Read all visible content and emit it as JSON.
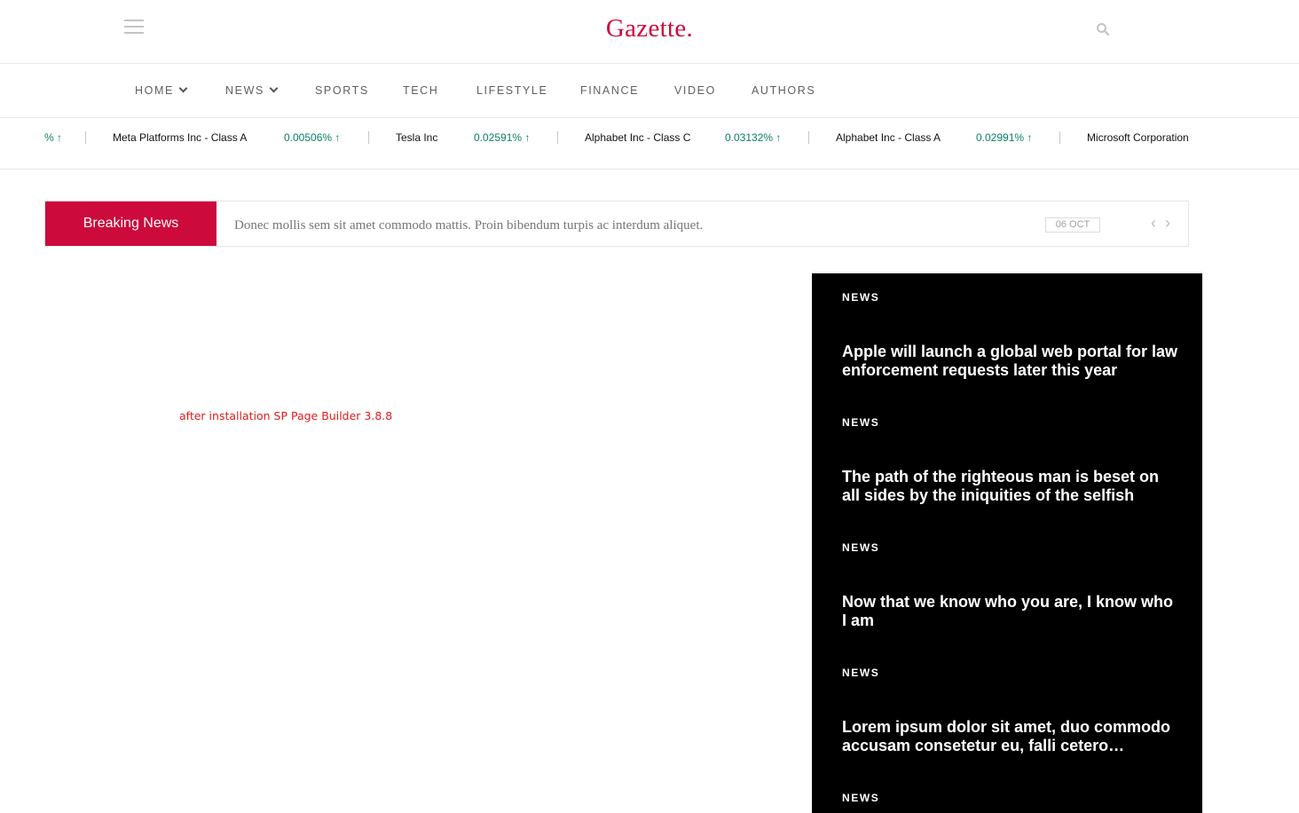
{
  "header": {
    "logo": "Gazette.",
    "menu_icon": "hamburger-menu-icon",
    "search_icon": "search-icon"
  },
  "nav": [
    {
      "label": "HOME",
      "has_dropdown": true
    },
    {
      "label": "NEWS",
      "has_dropdown": true
    },
    {
      "label": "SPORTS",
      "has_dropdown": false
    },
    {
      "label": "TECH",
      "has_dropdown": false
    },
    {
      "label": "LIFESTYLE",
      "has_dropdown": false
    },
    {
      "label": "FINANCE",
      "has_dropdown": false
    },
    {
      "label": "VIDEO",
      "has_dropdown": false
    },
    {
      "label": "AUTHORS",
      "has_dropdown": false
    }
  ],
  "ticker": {
    "partial_leading_value": "%",
    "items": [
      {
        "name": "Meta Platforms Inc - Class A",
        "change": "0.00506%"
      },
      {
        "name": "Tesla Inc",
        "change": "0.02591%"
      },
      {
        "name": "Alphabet Inc - Class C",
        "change": "0.03132%"
      },
      {
        "name": "Alphabet Inc - Class A",
        "change": "0.02991%"
      },
      {
        "name": "Microsoft Corporation",
        "change": ""
      }
    ],
    "arrow": "↑",
    "up_color": "#0a7e62"
  },
  "breaking": {
    "label": "Breaking News",
    "headline": "Donec mollis sem sit amet commodo mattis. Proin bibendum turpis ac interdum aliquet.",
    "date": "06 OCT",
    "prev_icon": "chevron-left-icon",
    "next_icon": "chevron-right-icon",
    "accent": "#cd0a3c"
  },
  "note": "after installation SP Page Builder 3.8.8",
  "panel": {
    "items": [
      {
        "category": "NEWS",
        "title": "Apple will launch a global web portal for law enforcement requests later this year"
      },
      {
        "category": "NEWS",
        "title": "The path of the righteous man is beset on all sides by the iniquities of the selfish"
      },
      {
        "category": "NEWS",
        "title": "Now that we know who you are, I know who I am"
      },
      {
        "category": "NEWS",
        "title": "Lorem ipsum dolor sit amet, duo commodo accusam consetetur eu, falli cetero…"
      },
      {
        "category": "NEWS",
        "title": ""
      }
    ]
  }
}
